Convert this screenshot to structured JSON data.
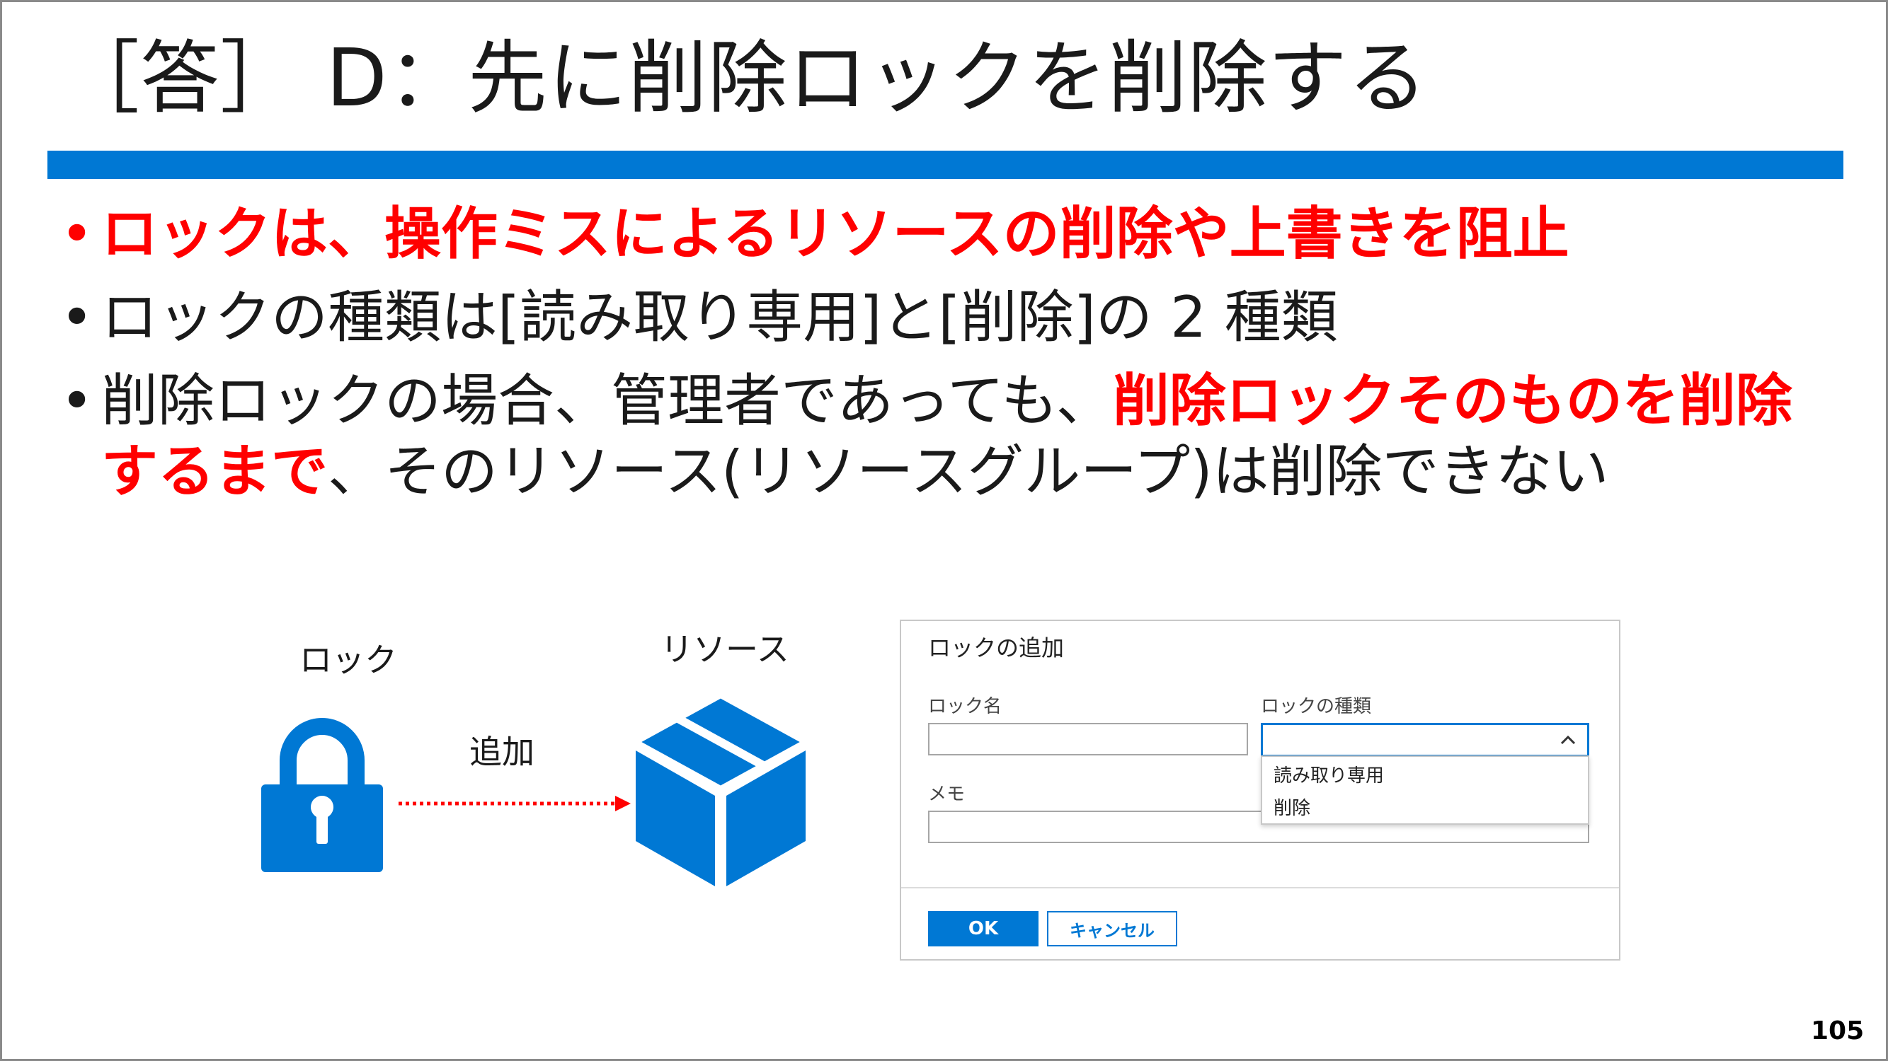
{
  "slide": {
    "title": "［答］ D：先に削除ロックを削除する",
    "page_number": "105",
    "accent_color": "#0078d4",
    "highlight_color": "#ff0000"
  },
  "bullets": [
    {
      "dot": "•",
      "text_red": "ロックは、操作ミスによるリソースの削除や上書きを阻止"
    },
    {
      "dot": "•",
      "text": "ロックの種類は[読み取り専用]と[削除]の 2 種類"
    },
    {
      "dot": "•",
      "text_before": "削除ロックの場合、管理者であっても、",
      "text_red": "削除ロックそのものを削除するまで",
      "text_after": "、そのリソース(リソースグループ)は削除できない"
    }
  ],
  "diagram": {
    "lock_label": "ロック",
    "arrow_label": "追加",
    "resource_label": "リソース",
    "lock_icon": "lock-icon",
    "resource_icon": "cube-box-icon"
  },
  "dialog": {
    "title": "ロックの追加",
    "lock_name_label": "ロック名",
    "lock_name_value": "",
    "lock_type_label": "ロックの種類",
    "lock_type_value": "",
    "memo_label": "メモ",
    "memo_value": "",
    "lock_type_options": [
      "読み取り専用",
      "削除"
    ],
    "ok_label": "OK",
    "cancel_label": "キャンセル"
  }
}
